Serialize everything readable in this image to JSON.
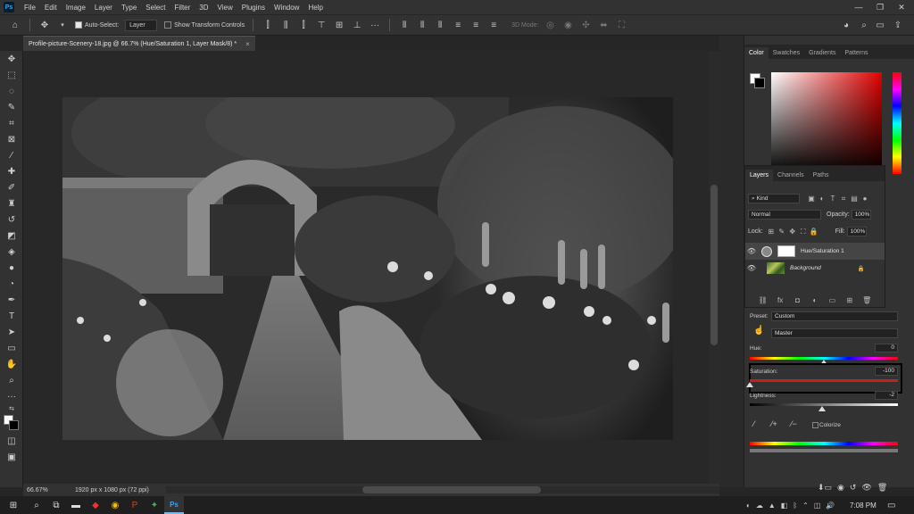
{
  "menu": {
    "logo": "Ps",
    "items": [
      "File",
      "Edit",
      "Image",
      "Layer",
      "Type",
      "Select",
      "Filter",
      "3D",
      "View",
      "Plugins",
      "Window",
      "Help"
    ],
    "window_controls": [
      "—",
      "❐",
      "✕"
    ]
  },
  "options_bar": {
    "auto_select_label": "Auto-Select:",
    "auto_select_value": "Layer",
    "show_transform_label": "Show Transform Controls",
    "mode_3d_label": "3D Mode:",
    "more_label": "···"
  },
  "document": {
    "tab_title": "Profile-picture-Scenery-18.jpg @ 66.7% (Hue/Saturation 1, Layer Mask/8) *",
    "tab_close": "×"
  },
  "status": {
    "zoom": "66.67%",
    "doc_size": "1920 px x 1080 px (72 ppi)"
  },
  "color_panel": {
    "tabs": [
      "Color",
      "Swatches",
      "Gradients",
      "Patterns"
    ],
    "active_tab": "Color"
  },
  "layers_panel": {
    "tabs": [
      "Layers",
      "Channels",
      "Paths"
    ],
    "filter_label": "Kind",
    "blend_mode": "Normal",
    "opacity_label": "Opacity:",
    "opacity_value": "100%",
    "lock_label": "Lock:",
    "fill_label": "Fill:",
    "fill_value": "100%",
    "layers": [
      {
        "name": "Hue/Saturation 1",
        "type": "adjustment",
        "selected": true
      },
      {
        "name": "Background",
        "type": "image",
        "selected": false
      }
    ]
  },
  "properties_panel": {
    "preset_label": "Preset:",
    "preset_value": "Custom",
    "channel_value": "Master",
    "hue_label": "Hue:",
    "hue_value": "0",
    "saturation_label": "Saturation:",
    "saturation_value": "-100",
    "lightness_label": "Lightness:",
    "lightness_value": "-2",
    "colorize_label": "Colorize",
    "hue_level": 0.5,
    "saturation_level": 0.0,
    "lightness_level": 0.49
  },
  "taskbar": {
    "time": "7:08 PM"
  },
  "colors": {
    "panel_bg": "#323232",
    "canvas_bg": "#282828",
    "saturation_track": "#c81e1e",
    "accent": "#31a8ff"
  }
}
